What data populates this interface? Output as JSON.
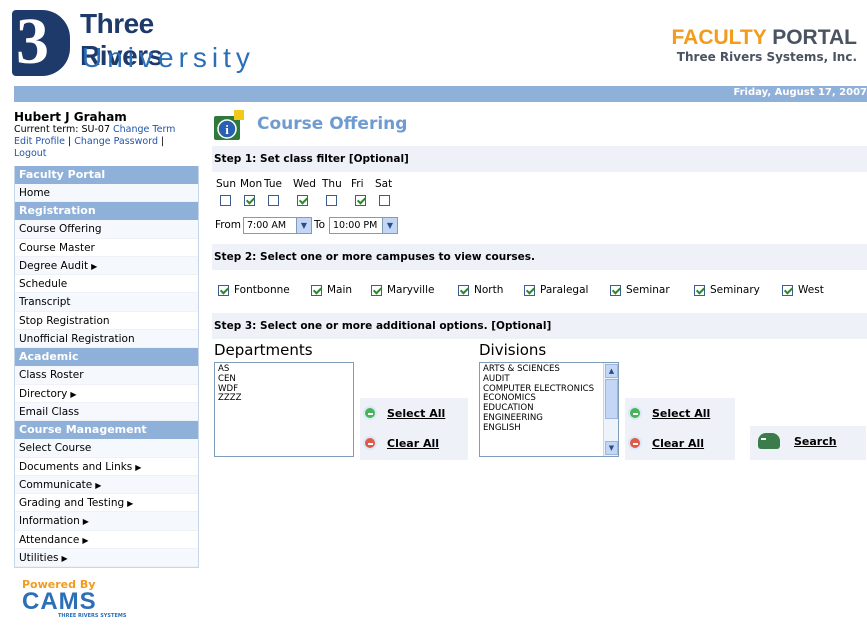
{
  "brand": {
    "name1": "Three Rivers",
    "name2": "University",
    "portal_title_a": "FACULTY",
    "portal_title_b": "PORTAL",
    "company": "Three Rivers Systems, Inc."
  },
  "date": "Friday, August 17, 2007",
  "user": {
    "name": "Hubert J Graham",
    "term_label": "Current term: SU-07",
    "change_term": "Change Term",
    "edit_profile": "Edit Profile",
    "change_password": "Change Password",
    "logout": "Logout"
  },
  "nav": [
    {
      "section": "Faculty Portal",
      "items": [
        {
          "label": "Home"
        }
      ]
    },
    {
      "section": "Registration",
      "items": [
        {
          "label": "Course Offering"
        },
        {
          "label": "Course Master"
        },
        {
          "label": "Degree Audit",
          "arrow": "▶"
        },
        {
          "label": "Schedule"
        },
        {
          "label": "Transcript"
        },
        {
          "label": "Stop Registration"
        },
        {
          "label": "Unofficial Registration"
        }
      ]
    },
    {
      "section": "Academic",
      "items": [
        {
          "label": "Class Roster"
        },
        {
          "label": "Directory",
          "arrow": "▶"
        },
        {
          "label": "Email Class"
        }
      ]
    },
    {
      "section": "Course Management",
      "items": [
        {
          "label": "Select Course"
        },
        {
          "label": "Documents and Links",
          "arrow": "▶"
        },
        {
          "label": "Communicate",
          "arrow": "▶"
        },
        {
          "label": "Grading and Testing",
          "arrow": "▶"
        },
        {
          "label": "Information",
          "arrow": "▶"
        },
        {
          "label": "Attendance",
          "arrow": "▶"
        },
        {
          "label": "Utilities",
          "arrow": "▶"
        }
      ]
    }
  ],
  "powered": {
    "text": "Powered By",
    "logo": "CAMS",
    "logo_sub": "THREE RIVERS SYSTEMS"
  },
  "page": {
    "title": "Course Offering"
  },
  "step1": {
    "title": "Step 1: Set class filter [Optional]",
    "days": [
      {
        "label": "Sun",
        "checked": false
      },
      {
        "label": "Mon",
        "checked": true
      },
      {
        "label": "Tue",
        "checked": false
      },
      {
        "label": "Wed",
        "checked": true
      },
      {
        "label": "Thu",
        "checked": false
      },
      {
        "label": "Fri",
        "checked": true
      },
      {
        "label": "Sat",
        "checked": false
      }
    ],
    "from_label": "From",
    "from_value": "7:00 AM",
    "to_label": "To",
    "to_value": "10:00 PM"
  },
  "step2": {
    "title": "Step 2: Select one or more campuses to view courses.",
    "campuses": [
      {
        "label": "Fontbonne",
        "checked": true
      },
      {
        "label": "Main",
        "checked": true
      },
      {
        "label": "Maryville",
        "checked": true
      },
      {
        "label": "North",
        "checked": true
      },
      {
        "label": "Paralegal",
        "checked": true
      },
      {
        "label": "Seminar",
        "checked": true
      },
      {
        "label": "Seminary",
        "checked": true
      },
      {
        "label": "West",
        "checked": true
      }
    ]
  },
  "step3": {
    "title": "Step 3: Select one or more additional options. [Optional]",
    "departments": {
      "label": "Departments",
      "options": [
        "AS",
        "CEN",
        "WDF",
        "ZZZZ"
      ]
    },
    "divisions": {
      "label": "Divisions",
      "options": [
        "ARTS & SCIENCES",
        "AUDIT",
        "COMPUTER ELECTRONICS",
        "ECONOMICS",
        "EDUCATION",
        "ENGINEERING",
        "ENGLISH"
      ]
    },
    "select_all": "Select All",
    "clear_all": "Clear All",
    "search": "Search"
  }
}
